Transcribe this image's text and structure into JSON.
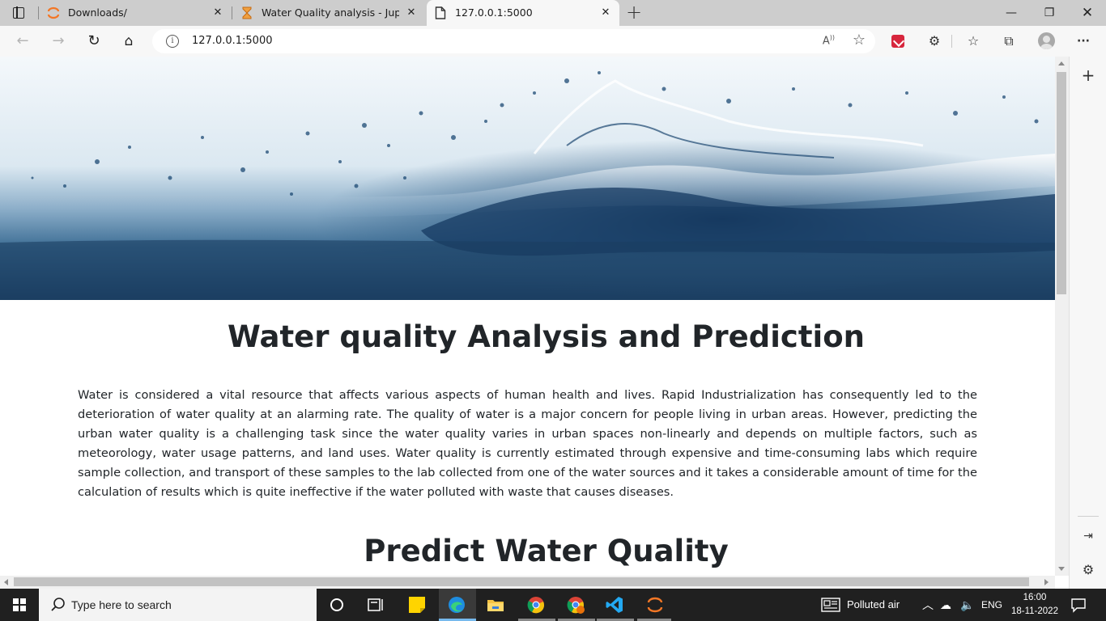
{
  "browser": {
    "tabs": [
      {
        "title": "Downloads/",
        "active": false
      },
      {
        "title": "Water Quality analysis - Jupyter",
        "active": false
      },
      {
        "title": "127.0.0.1:5000",
        "active": true
      }
    ],
    "address": "127.0.0.1:5000",
    "read_aloud": "A",
    "icons": {
      "back": "back-arrow-icon",
      "forward": "forward-arrow-icon",
      "refresh": "refresh-icon",
      "home": "home-icon",
      "site_info": "info-icon",
      "favorite": "add-favorite-icon",
      "extensions": "extensions-icon",
      "favorites": "favorites-icon",
      "collections": "collections-icon",
      "menu": "more-icon"
    },
    "window_controls": [
      "minimize",
      "restore",
      "close"
    ]
  },
  "page": {
    "title": "Water quality Analysis and Prediction",
    "intro": "Water is considered a vital resource that affects various aspects of human health and lives. Rapid Industrialization has consequently led to the deterioration of water quality at an alarming rate. The quality of water is a major concern for people living in urban areas. However, predicting the urban water quality is a challenging task since the water quality varies in urban spaces non-linearly and depends on multiple factors, such as meteorology, water usage patterns, and land uses. Water quality is currently estimated through expensive and time-consuming labs which require sample collection, and transport of these samples to the lab collected from one of the water sources and it takes a considerable amount of time for the calculation of results which is quite ineffective if the water polluted with waste that causes diseases.",
    "section_title": "Predict Water Quality"
  },
  "taskbar": {
    "search_placeholder": "Type here to search",
    "weather": "Polluted air",
    "language": "ENG",
    "time": "16:00",
    "date": "18-11-2022"
  },
  "colors": {
    "accent": "#76b9ed",
    "taskbar": "#202020",
    "text": "#212529"
  }
}
